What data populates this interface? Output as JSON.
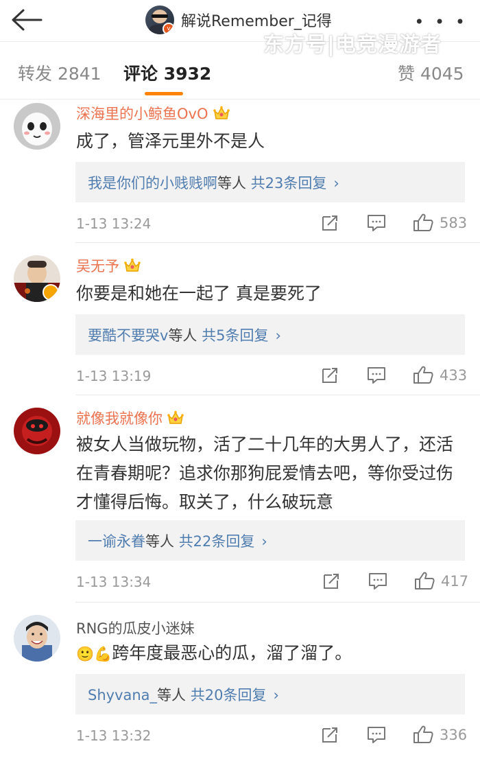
{
  "header": {
    "back_label": "",
    "title": "解说Remember_记得",
    "verified_badge": "v",
    "more_label": "• • •",
    "watermark": "东方号|电竞漫游者"
  },
  "tabs": [
    {
      "label": "转发 2841"
    },
    {
      "label": "评论 3932",
      "active": true
    },
    {
      "label": "赞 4045"
    }
  ],
  "colors": {
    "accent": "#ff8200",
    "vip_name": "#eb7350",
    "link": "#507daf"
  },
  "comments": [
    {
      "user": "深海里的小鲸鱼OvO",
      "vip": true,
      "text": "成了，管泽元里外不是人",
      "reply_users": "我是你们的小贱贱啊",
      "reply_mid": "等人",
      "reply_count": "共23条回复",
      "reply_chevron": "›",
      "time": "1-13 13:24",
      "likes": "583"
    },
    {
      "user": "吴无予",
      "vip": true,
      "text": "你要是和她在一起了 真是要死了",
      "reply_users": "要酷不要哭v",
      "reply_mid": "等人",
      "reply_count": "共5条回复",
      "reply_chevron": "›",
      "time": "1-13 13:19",
      "likes": "433"
    },
    {
      "user": "就像我就像你",
      "vip": true,
      "text": "被女人当做玩物，活了二十几年的大男人了，还活在青春期呢？追求你那狗屁爱情去吧，等你受过伤才懂得后悔。取关了，什么破玩意",
      "reply_users": "一谕永眷",
      "reply_mid": "等人",
      "reply_count": "共22条回复",
      "reply_chevron": "›",
      "time": "1-13 13:34",
      "likes": "417"
    },
    {
      "user": "RNG的瓜皮小迷妹",
      "vip": false,
      "emoji": "🙂💪",
      "text": "跨年度最恶心的瓜，溜了溜了。",
      "reply_users": "Shyvana_",
      "reply_mid": "等人",
      "reply_count": "共20条回复",
      "reply_chevron": "›",
      "time": "1-13 13:32",
      "likes": "336"
    }
  ]
}
